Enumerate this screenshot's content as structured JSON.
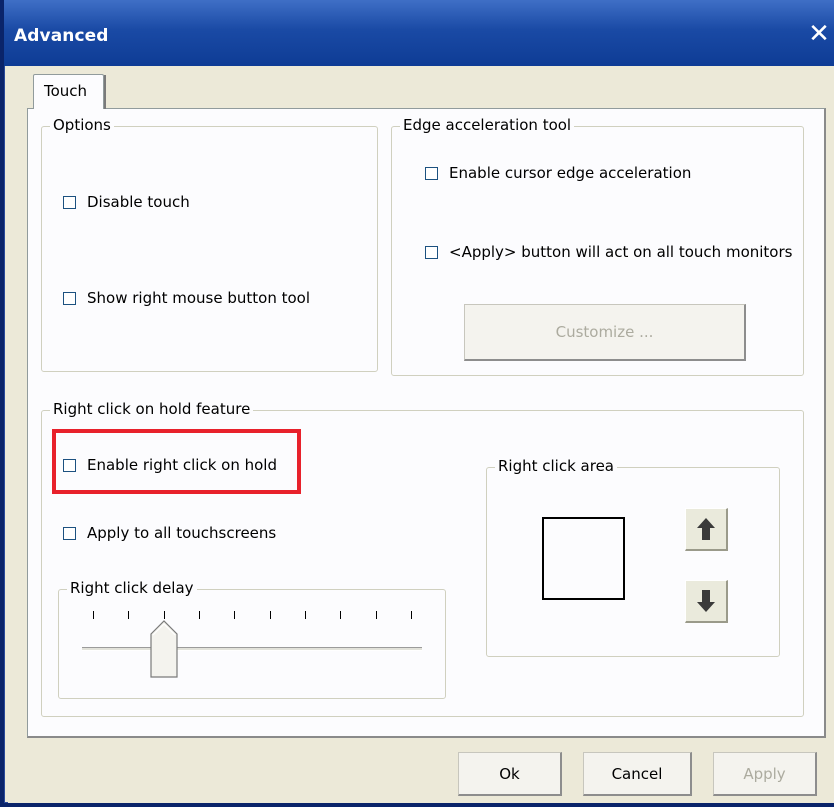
{
  "window": {
    "title": "Advanced",
    "close_icon": "close-icon"
  },
  "tabs": [
    {
      "label": "Touch",
      "selected": true
    }
  ],
  "options": {
    "title": "Options",
    "disable_touch": {
      "label": "Disable touch",
      "checked": false
    },
    "show_rmb_tool": {
      "label": "Show right mouse button tool",
      "checked": false
    }
  },
  "edge": {
    "title": "Edge acceleration tool",
    "enable_edge": {
      "label": "Enable cursor edge acceleration",
      "checked": false
    },
    "apply_all_monitors": {
      "label": "<Apply> button will act on all touch monitors",
      "checked": false
    },
    "customize_label": "Customize ..."
  },
  "right_click_hold": {
    "title": "Right click on hold feature",
    "enable": {
      "label": "Enable right click on hold",
      "checked": false
    },
    "apply_all": {
      "label": "Apply to all touchscreens",
      "checked": false
    },
    "delay": {
      "title": "Right click delay",
      "tick_count": 10,
      "value_index": 2
    },
    "area": {
      "title": "Right click area",
      "up_icon": "arrow-up-icon",
      "down_icon": "arrow-down-icon"
    }
  },
  "buttons": {
    "ok": "Ok",
    "cancel": "Cancel",
    "apply": "Apply"
  },
  "colors": {
    "titlebar": "#0e3c95",
    "highlight": "#e8212b",
    "face": "#ece9d8"
  }
}
